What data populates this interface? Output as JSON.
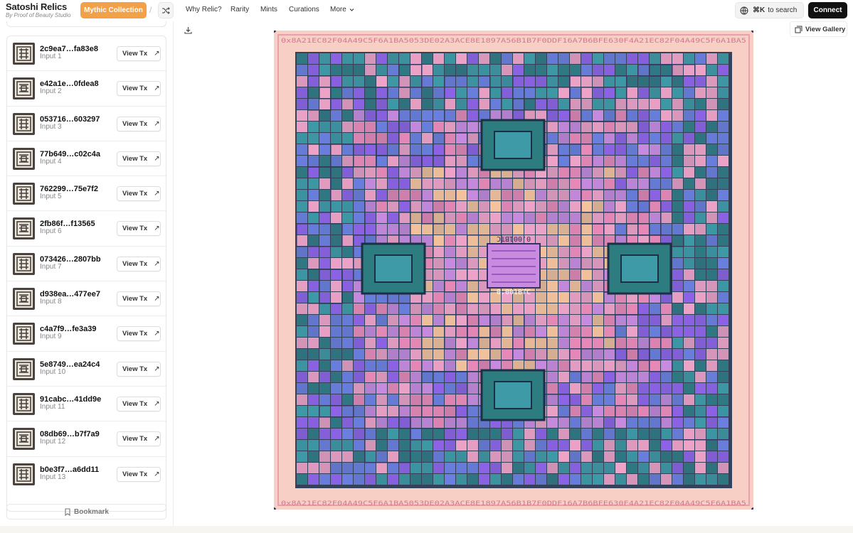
{
  "header": {
    "app_title": "Satoshi Relics",
    "app_subtitle": "By Proof of Beauty Studio",
    "collection_button": "Mythic Collection",
    "nav": [
      "Why Relic?",
      "Rarity",
      "Mints",
      "Curations",
      "More"
    ],
    "search_shortcut": "⌘K",
    "search_label": "to search",
    "connect_label": "Connect"
  },
  "sidebar": {
    "view_tx_label": "View Tx",
    "inputs": [
      {
        "hash": "2c9ea7…fa83e8",
        "label": "Input 1"
      },
      {
        "hash": "e42a1e…0fdea8",
        "label": "Input 2"
      },
      {
        "hash": "053716…603297",
        "label": "Input 3"
      },
      {
        "hash": "77b649…c02c4a",
        "label": "Input 4"
      },
      {
        "hash": "762299…75e7f2",
        "label": "Input 5"
      },
      {
        "hash": "2fb86f…f13565",
        "label": "Input 6"
      },
      {
        "hash": "073426…2807bb",
        "label": "Input 7"
      },
      {
        "hash": "d938ea…477ee7",
        "label": "Input 8"
      },
      {
        "hash": "c4a7f9…fe3a39",
        "label": "Input 9"
      },
      {
        "hash": "5e8749…ea24c4",
        "label": "Input 10"
      },
      {
        "hash": "91cabc…41dd9e",
        "label": "Input 11"
      },
      {
        "hash": "08db69…b7f7a9",
        "label": "Input 12"
      },
      {
        "hash": "b0e3f7…a6dd11",
        "label": "Input 13"
      }
    ],
    "bookmark_label": "Bookmark"
  },
  "main": {
    "gallery_label": "View Gallery",
    "artwork_center_text": "0.001BTC",
    "artwork_border_hex": "0x8A21EC82F04A49C5F6A1BA5053DE02A3ACE8E1897A56B1B7F0DDF16A7B6BFE630F4A21EC82F04A49C5F6A1BA5"
  },
  "colors": {
    "accent": "#f3a148",
    "art_pink": "#f0a3c8",
    "art_purple": "#8e63e8",
    "art_teal": "#2f7a84",
    "art_peach": "#f6c39c",
    "art_dark": "#1f3b55"
  }
}
